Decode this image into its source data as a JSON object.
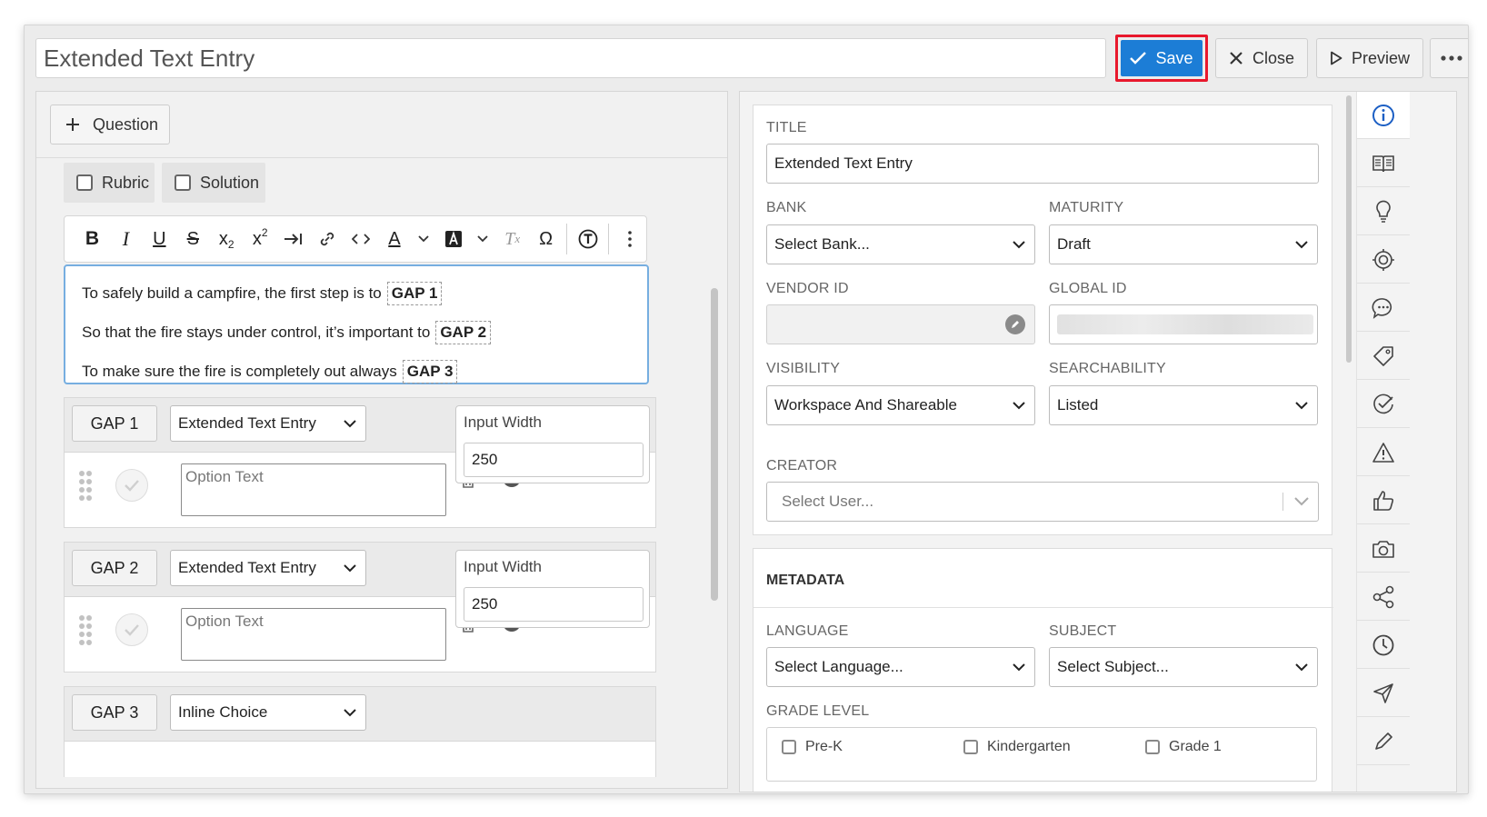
{
  "header": {
    "title": "Extended Text Entry",
    "save_label": "Save",
    "close_label": "Close",
    "preview_label": "Preview"
  },
  "left": {
    "add_question_label": "Question",
    "rubric_label": "Rubric",
    "solution_label": "Solution",
    "editor_lines": [
      {
        "text": "To safely build a campfire, the first step is to",
        "gap": "GAP 1"
      },
      {
        "text": "So that the fire stays under control, it’s important to",
        "gap": "GAP 2"
      },
      {
        "text": "To make sure the fire is completely out always",
        "gap": "GAP 3"
      }
    ],
    "gaps": [
      {
        "label": "GAP 1",
        "type": "Extended Text Entry",
        "input_width_label": "Input Width",
        "input_width": "250",
        "option_placeholder": "Option Text"
      },
      {
        "label": "GAP 2",
        "type": "Extended Text Entry",
        "input_width_label": "Input Width",
        "input_width": "250",
        "option_placeholder": "Option Text"
      },
      {
        "label": "GAP 3",
        "type": "Inline Choice"
      }
    ]
  },
  "props": {
    "title_label": "TITLE",
    "title_value": "Extended Text Entry",
    "bank_label": "BANK",
    "bank_value": "Select Bank...",
    "maturity_label": "MATURITY",
    "maturity_value": "Draft",
    "vendor_label": "VENDOR ID",
    "global_label": "GLOBAL ID",
    "visibility_label": "VISIBILITY",
    "visibility_value": "Workspace And Shareable",
    "searchability_label": "SEARCHABILITY",
    "searchability_value": "Listed",
    "creator_label": "CREATOR",
    "creator_placeholder": "Select User..."
  },
  "metadata": {
    "title": "METADATA",
    "language_label": "LANGUAGE",
    "language_value": "Select Language...",
    "subject_label": "SUBJECT",
    "subject_value": "Select Subject...",
    "grade_label": "GRADE LEVEL",
    "grades": [
      "Pre-K",
      "Kindergarten",
      "Grade 1"
    ]
  },
  "rail_icons": [
    "info-icon",
    "book-icon",
    "lightbulb-icon",
    "target-icon",
    "comment-icon",
    "tag-icon",
    "check-circle-icon",
    "warning-icon",
    "thumbs-up-icon",
    "camera-icon",
    "share-icon",
    "clock-icon",
    "send-icon",
    "pen-icon"
  ],
  "colors": {
    "accent": "#1c7dd6",
    "highlight": "#e8182c",
    "rail_active": "#1c5fc4"
  }
}
